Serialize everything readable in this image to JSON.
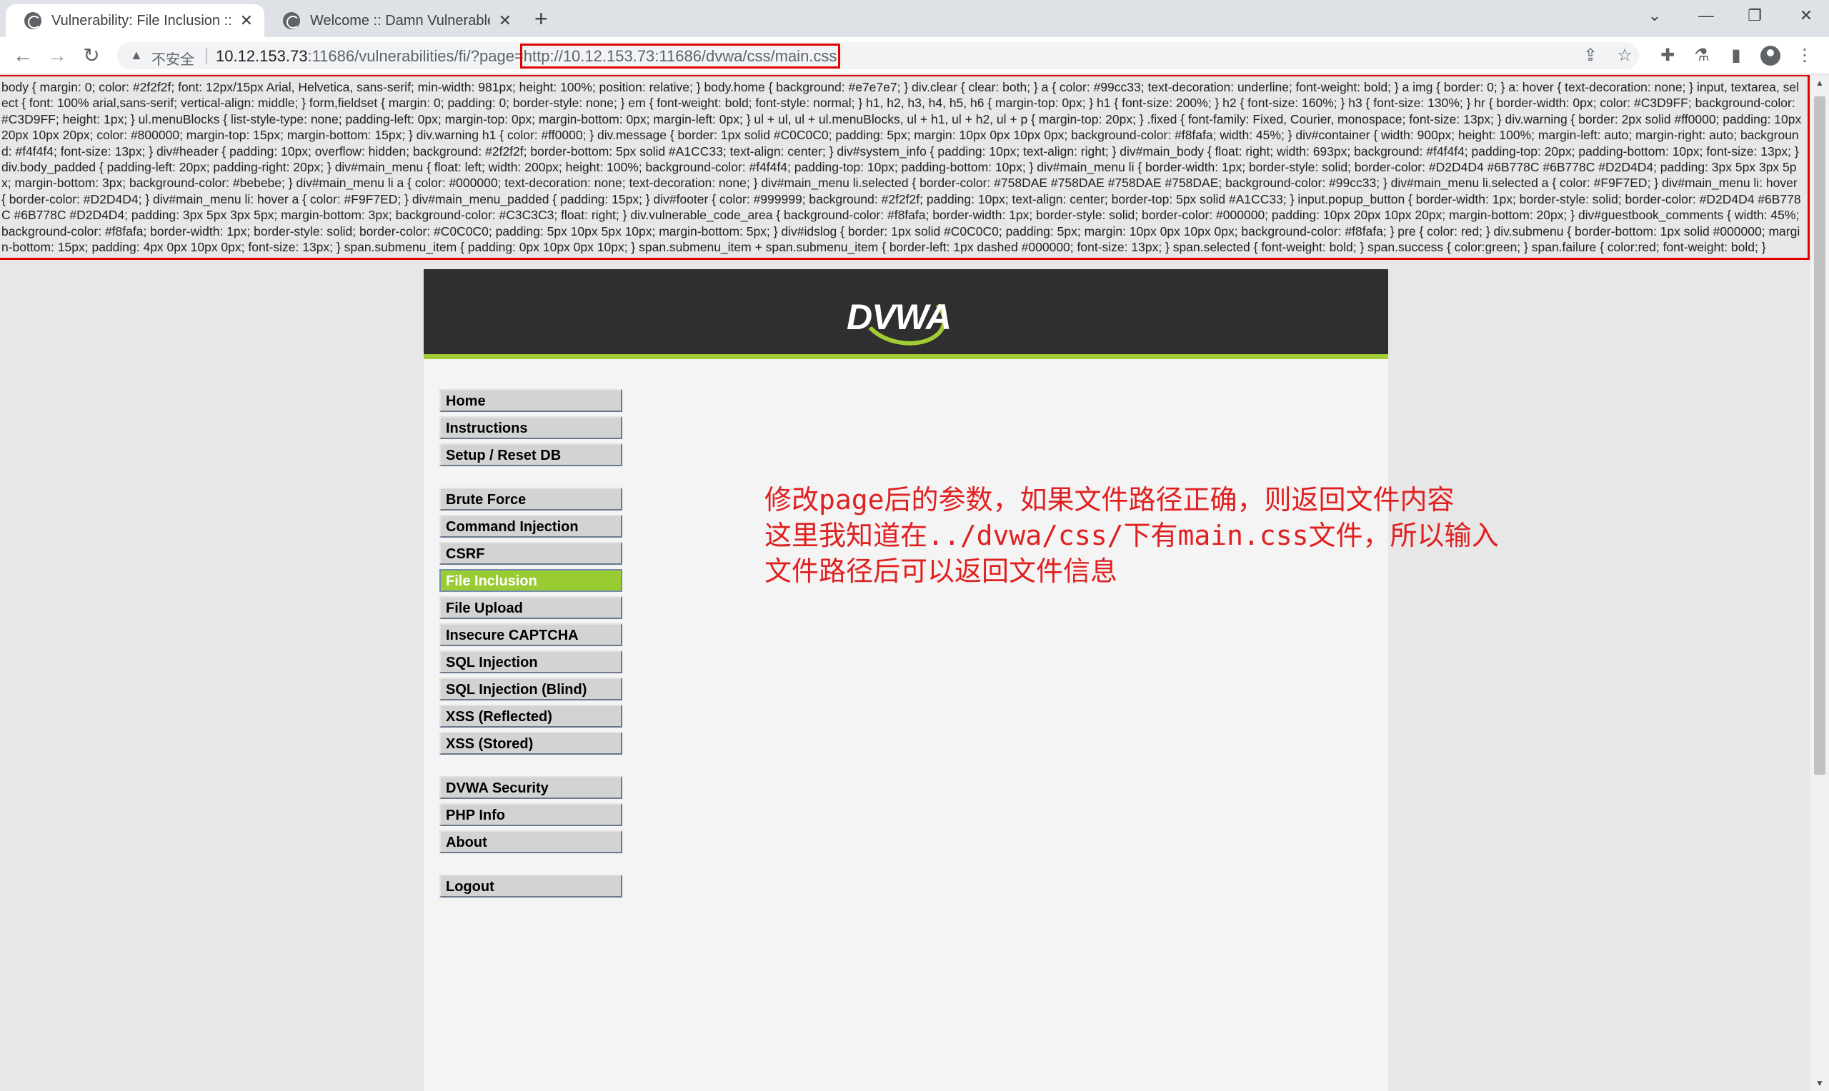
{
  "browser": {
    "tabs": [
      {
        "title": "Vulnerability: File Inclusion :: D",
        "active": true
      },
      {
        "title": "Welcome :: Damn Vulnerable V",
        "active": false
      }
    ],
    "new_tab": "+",
    "window_controls": {
      "minimize": "⌄",
      "min": "—",
      "restore": "❐",
      "close": "✕"
    },
    "nav": {
      "back": "←",
      "forward": "→",
      "reload": "↻"
    },
    "address_bar": {
      "security_label": "不安全",
      "host": "10.12.153.73",
      "path": ":11686/vulnerabilities/fi/?page=",
      "page_param": "http://10.12.153.73:11686/dvwa/css/main.css"
    },
    "toolbar_icons": [
      "share-icon",
      "star-icon",
      "extensions-icon",
      "lab-icon",
      "sidebar-icon",
      "profile-icon",
      "menu-icon"
    ]
  },
  "css_dump": "body { margin: 0; color: #2f2f2f; font: 12px/15px Arial, Helvetica, sans-serif; min-width: 981px; height: 100%; position: relative; } body.home { background: #e7e7e7; } div.clear { clear: both; } a { color: #99cc33; text-decoration: underline; font-weight: bold; } a img { border: 0; } a: hover { text-decoration: none; } input, textarea, select { font: 100% arial,sans-serif; vertical-align: middle; } form,fieldset { margin: 0; padding: 0; border-style: none; } em { font-weight: bold; font-style: normal; } h1, h2, h3, h4, h5, h6 { margin-top: 0px; } h1 { font-size: 200%; } h2 { font-size: 160%; } h3 { font-size: 130%; } hr { border-width: 0px; color: #C3D9FF; background-color: #C3D9FF; height: 1px; } ul.menuBlocks { list-style-type: none; padding-left: 0px; margin-top: 0px; margin-bottom: 0px; margin-left: 0px; } ul + ul, ul + ul.menuBlocks, ul + h1, ul + h2, ul + p { margin-top: 20px; } .fixed { font-family: Fixed, Courier, monospace; font-size: 13px; } div.warning { border: 2px solid #ff0000; padding: 10px 20px 10px 20px; color: #800000; margin-top: 15px; margin-bottom: 15px; } div.warning h1 { color: #ff0000; } div.message { border: 1px solid #C0C0C0; padding: 5px; margin: 10px 0px 10px 0px; background-color: #f8fafa; width: 45%; } div#container { width: 900px; height: 100%; margin-left: auto; margin-right: auto; background: #f4f4f4; font-size: 13px; } div#header { padding: 10px; overflow: hidden; background: #2f2f2f; border-bottom: 5px solid #A1CC33; text-align: center; } div#system_info { padding: 10px; text-align: right; } div#main_body { float: right; width: 693px; background: #f4f4f4; padding-top: 20px; padding-bottom: 10px; font-size: 13px; } div.body_padded { padding-left: 20px; padding-right: 20px; } div#main_menu { float: left; width: 200px; height: 100%; background-color: #f4f4f4; padding-top: 10px; padding-bottom: 10px; } div#main_menu li { border-width: 1px; border-style: solid; border-color: #D2D4D4 #6B778C #6B778C #D2D4D4; padding: 3px 5px 3px 5px; margin-bottom: 3px; background-color: #bebebe; } div#main_menu li a { color: #000000; text-decoration: none; text-decoration: none; } div#main_menu li.selected { border-color: #758DAE #758DAE #758DAE #758DAE; background-color: #99cc33; } div#main_menu li.selected a { color: #F9F7ED; } div#main_menu li: hover { border-color: #D2D4D4; } div#main_menu li: hover a { color: #F9F7ED; } div#main_menu_padded { padding: 15px; } div#footer { color: #999999; background: #2f2f2f; padding: 10px; text-align: center; border-top: 5px solid #A1CC33; } input.popup_button { border-width: 1px; border-style: solid; border-color: #D2D4D4 #6B778C #6B778C #D2D4D4; padding: 3px 5px 3px 5px; margin-bottom: 3px; background-color: #C3C3C3; float: right; } div.vulnerable_code_area { background-color: #f8fafa; border-width: 1px; border-style: solid; border-color: #000000; padding: 10px 20px 10px 20px; margin-bottom: 20px; } div#guestbook_comments { width: 45%; background-color: #f8fafa; border-width: 1px; border-style: solid; border-color: #C0C0C0; padding: 5px 10px 5px 10px; margin-bottom: 5px; } div#idslog { border: 1px solid #C0C0C0; padding: 5px; margin: 10px 0px 10px 0px; background-color: #f8fafa; } pre { color: red; } div.submenu { border-bottom: 1px solid #000000; margin-bottom: 15px; padding: 4px 0px 10px 0px; font-size: 13px; } span.submenu_item { padding: 0px 10px 0px 10px; } span.submenu_item + span.submenu_item { border-left: 1px dashed #000000; font-size: 13px; } span.selected { font-weight: bold; } span.success { color:green; } span.failure { color:red; font-weight: bold; }",
  "dvwa": {
    "logo_text": "DVWA",
    "menu_groups": [
      [
        {
          "label": "Home"
        },
        {
          "label": "Instructions"
        },
        {
          "label": "Setup / Reset DB"
        }
      ],
      [
        {
          "label": "Brute Force"
        },
        {
          "label": "Command Injection"
        },
        {
          "label": "CSRF"
        },
        {
          "label": "File Inclusion",
          "selected": true
        },
        {
          "label": "File Upload"
        },
        {
          "label": "Insecure CAPTCHA"
        },
        {
          "label": "SQL Injection"
        },
        {
          "label": "SQL Injection (Blind)"
        },
        {
          "label": "XSS (Reflected)"
        },
        {
          "label": "XSS (Stored)"
        }
      ],
      [
        {
          "label": "DVWA Security"
        },
        {
          "label": "PHP Info"
        },
        {
          "label": "About"
        }
      ],
      [
        {
          "label": "Logout"
        }
      ]
    ]
  },
  "annotation": {
    "lines": [
      "修改page后的参数，如果文件路径正确，则返回文件内容",
      "这里我知道在../dvwa/css/下有main.css文件，所以输入",
      "文件路径后可以返回文件信息"
    ]
  },
  "colors": {
    "accent": "#a1cc33",
    "selected": "#99cc33",
    "header": "#2f2f2f",
    "annotation": "#e02020",
    "highlight_box": "#e00000"
  }
}
